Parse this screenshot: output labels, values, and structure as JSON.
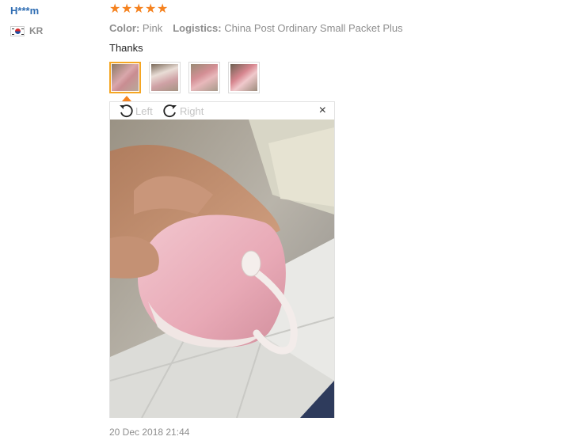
{
  "review": {
    "user_name": "H***m",
    "country": "KR",
    "rating": 5,
    "color_label": "Color:",
    "color_value": "Pink",
    "logistics_label": "Logistics:",
    "logistics_value": "China Post Ordinary Small Packet Plus",
    "feedback": "Thanks",
    "date": "20 Dec 2018 21:44"
  },
  "viewer": {
    "rotate_left_label": "Left",
    "rotate_right_label": "Right",
    "close_glyph": "×",
    "thumbnail_count": 4,
    "active_thumbnail": 1
  },
  "icons": {
    "star": "star-icon",
    "rotate_left": "rotate-left-icon",
    "rotate_right": "rotate-right-icon",
    "close": "close-icon",
    "flag": "flag-kr-icon"
  },
  "colors": {
    "accent": "#f5821f",
    "user_link": "#2f6db3",
    "muted_text": "#8e8e8e",
    "active_thumb_border": "#f5a623"
  }
}
